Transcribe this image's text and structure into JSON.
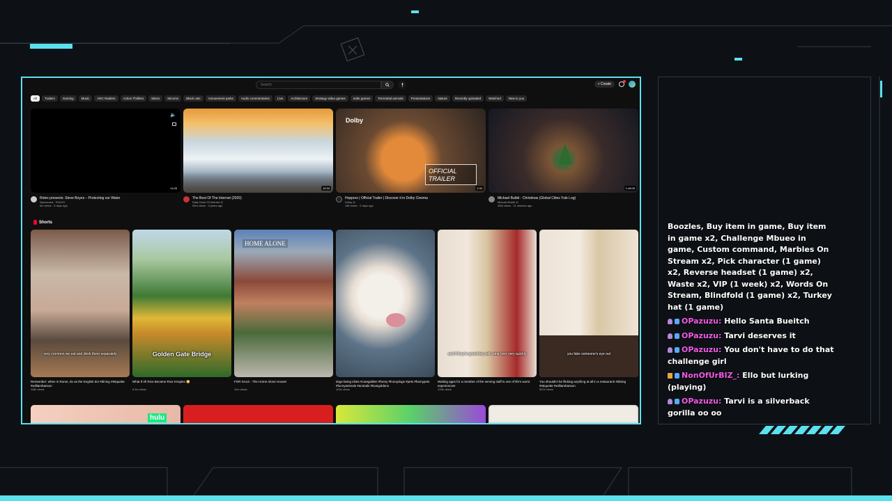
{
  "youtube": {
    "search_placeholder": "Search",
    "create_label": "Create",
    "chips": [
      "All",
      "Trailers",
      "Gaming",
      "Music",
      "ARC Raiders",
      "Action Thrillers",
      "Mixes",
      "Sitcoms",
      "Black cats",
      "Amusement parks",
      "Audio commentaries",
      "Live",
      "Architecture",
      "Strategy video games",
      "Indie games",
      "Terrestrial animals",
      "Presentations",
      "Nature",
      "Recently uploaded",
      "Watched",
      "New to you"
    ],
    "videos": [
      {
        "title": "Rolex presents: Steve Boyes – Protecting our Water",
        "channel": "Sponsored · ROLEX",
        "meta": "4m views · 5 days ago",
        "duration": "11:05"
      },
      {
        "title": "The Best Of The Internet (2020)",
        "channel": "Daily Dose Of Internet ◎",
        "meta": "99m views · 4 years ago",
        "duration": "12:34"
      },
      {
        "title": "Hoppers | Official Trailer | Discover it in Dolby Cinema",
        "channel": "Dolby ◎",
        "meta": "18k views · 2 days ago",
        "duration": "2:30",
        "logo_text": "Dolby",
        "badge_text": "OFFICIAL TRAILER"
      },
      {
        "title": "Michael Bublé - Christmas (Global Cities Yule Log)",
        "channel": "Michael Bublé ◎",
        "meta": "45M views · 11 minutes ago",
        "duration": "1:45:05"
      }
    ],
    "shorts_heading": "Shorts",
    "shorts": [
      {
        "title": "Remember: when in Rome, do as the English do! #dining #etiquette #williamhanson",
        "views": "118k views",
        "caption": "very common we eat and drink them separately"
      },
      {
        "title": "What If All Rice Became Rice Krispies 😳",
        "views": "5.4m views",
        "caption": "Golden Gate Bridge"
      },
      {
        "title": "FOR SALE - The Home Alone House!",
        "views": "11m views",
        "caption": "HOME ALONE"
      },
      {
        "title": "dogs being idiots #cutegolden #funny #funnydogs #pets #funnypets #funnyanimals #animals #lovegoldens",
        "views": "102k views",
        "caption": ""
      },
      {
        "title": "Waiting ages for a member of the serving staff is one of life's worst experiences!",
        "views": "133k views",
        "caption": "and if they're good they will come over very quickly"
      },
      {
        "title": "You shouldn't be flicking anything at all in a restaurant! #dining #etiquette #williamhanson",
        "views": "557k views",
        "caption": "you fake someone's eye out"
      }
    ],
    "row3_label": "hulu"
  },
  "chat": {
    "intro": "Boozles, Buy item in game, Buy item in game x2, Challenge Mbueo in game, Custom command, Marbles On Stream x2, Pick character (1 game) x2, Reverse headset (1 game) x2, Waste x2, VIP (1 week) x2, Words On Stream, Blindfold (1 game) x2, Turkey hat (1 game)",
    "messages": [
      {
        "user": "OPazuzu:",
        "text": "Hello Santa Bueitch"
      },
      {
        "user": "OPazuzu:",
        "text": "Tarvi deserves it"
      },
      {
        "user": "OPazuzu:",
        "text": "You don't have to do that challenge girl"
      },
      {
        "user": "NonOfUrBIZ_:",
        "text": "Ello but lurking (playing)"
      },
      {
        "user": "OPazuzu:",
        "text": "Tarvi is a silverback gorilla oo oo"
      }
    ]
  },
  "colors": {
    "accent": "#5be1ee",
    "chat_user": "#f25ae6",
    "yt_red": "#ff0033"
  }
}
